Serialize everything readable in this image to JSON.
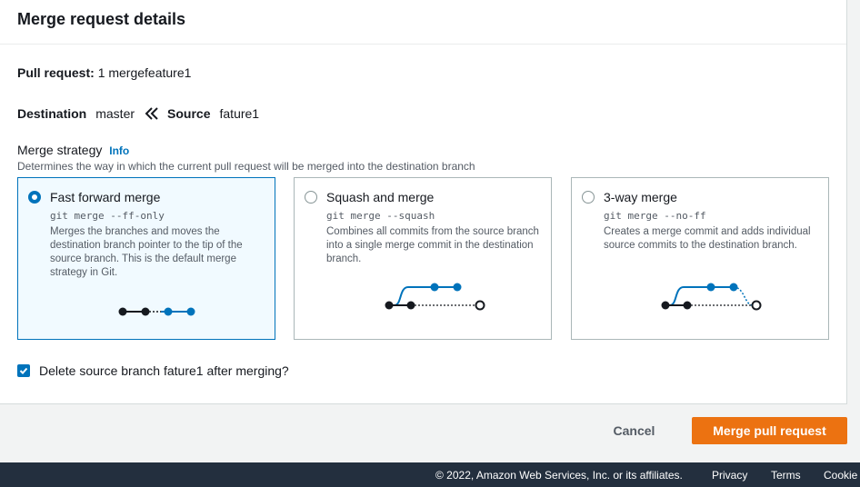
{
  "panel": {
    "title": "Merge request details"
  },
  "pull_request": {
    "label": "Pull request:",
    "value": "1 mergefeature1"
  },
  "branches": {
    "destination_label": "Destination",
    "destination_value": "master",
    "source_label": "Source",
    "source_value": "fature1",
    "arrow_icon": "double-chevron-left-icon"
  },
  "strategy": {
    "label": "Merge strategy",
    "info_link": "Info",
    "description": "Determines the way in which the current pull request will be merged into the destination branch",
    "options": [
      {
        "title": "Fast forward merge",
        "code": "git merge --ff-only",
        "description": "Merges the branches and moves the destination branch pointer to the tip of the source branch. This is the default merge strategy in Git.",
        "selected": true
      },
      {
        "title": "Squash and merge",
        "code": "git merge --squash",
        "description": "Combines all commits from the source branch into a single merge commit in the destination branch.",
        "selected": false
      },
      {
        "title": "3-way merge",
        "code": "git merge --no-ff",
        "description": "Creates a merge commit and adds individual source commits to the destination branch.",
        "selected": false
      }
    ]
  },
  "delete_branch": {
    "label": "Delete source branch fature1 after merging?",
    "checked": true
  },
  "actions": {
    "cancel_label": "Cancel",
    "merge_label": "Merge pull request"
  },
  "footer": {
    "copyright": "© 2022, Amazon Web Services, Inc. or its affiliates.",
    "privacy": "Privacy",
    "terms": "Terms",
    "cookie": "Cookie"
  },
  "colors": {
    "accent": "#0073bb",
    "primary_button": "#ec7211",
    "footer_bg": "#232f3e"
  }
}
